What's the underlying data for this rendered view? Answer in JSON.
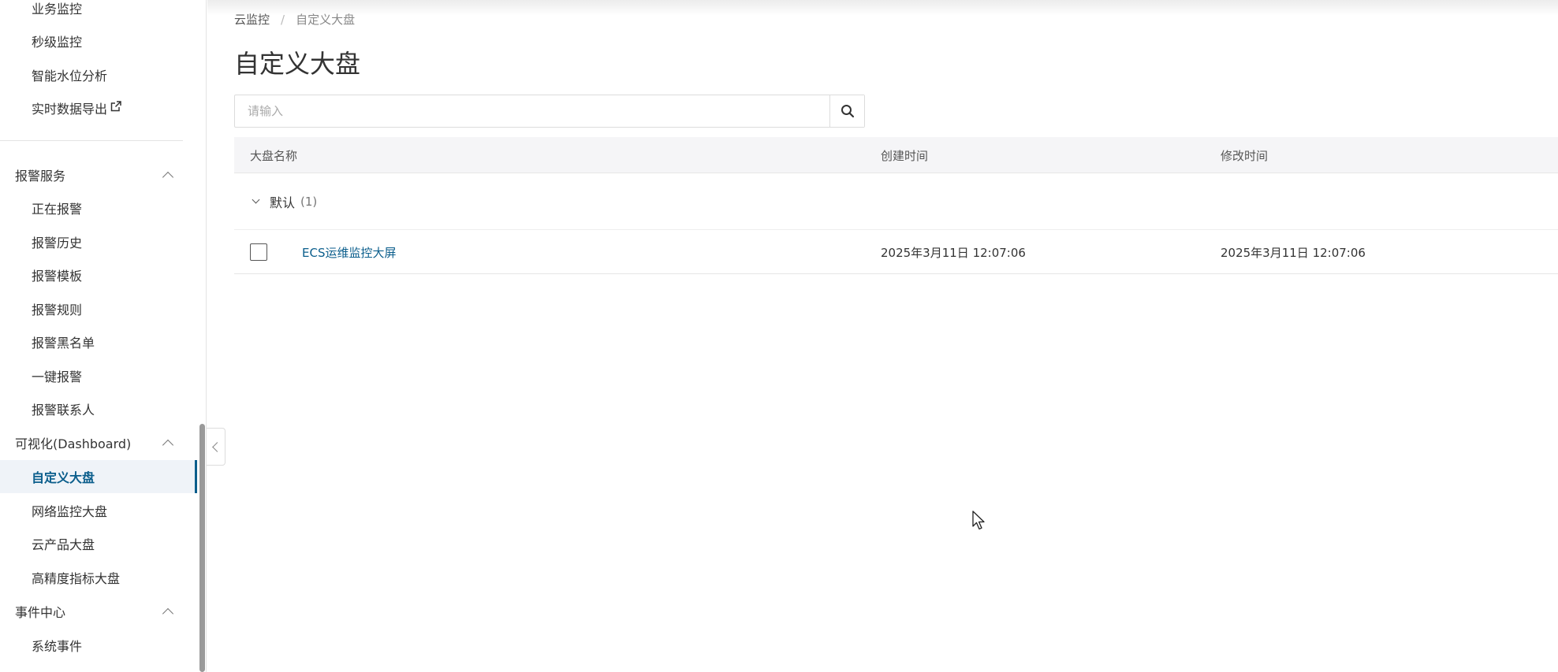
{
  "sidebar": {
    "top_items": [
      {
        "label": "业务监控"
      },
      {
        "label": "秒级监控"
      },
      {
        "label": "智能水位分析"
      },
      {
        "label": "实时数据导出"
      }
    ],
    "groups": [
      {
        "label": "报警服务",
        "items": [
          {
            "label": "正在报警"
          },
          {
            "label": "报警历史"
          },
          {
            "label": "报警模板"
          },
          {
            "label": "报警规则"
          },
          {
            "label": "报警黑名单"
          },
          {
            "label": "一键报警"
          },
          {
            "label": "报警联系人"
          }
        ]
      },
      {
        "label": "可视化(Dashboard)",
        "items": [
          {
            "label": "自定义大盘",
            "active": true
          },
          {
            "label": "网络监控大盘"
          },
          {
            "label": "云产品大盘"
          },
          {
            "label": "高精度指标大盘"
          }
        ]
      },
      {
        "label": "事件中心",
        "items": [
          {
            "label": "系统事件"
          }
        ]
      }
    ]
  },
  "breadcrumb": {
    "root": "云监控",
    "separator": "/",
    "current": "自定义大盘"
  },
  "page_title": "自定义大盘",
  "search": {
    "placeholder": "请输入",
    "value": ""
  },
  "table": {
    "columns": [
      "大盘名称",
      "创建时间",
      "修改时间"
    ],
    "group": {
      "name": "默认",
      "count": "(1)"
    },
    "rows": [
      {
        "name": "ECS运维监控大屏",
        "created": "2025年3月11日 12:07:06",
        "modified": "2025年3月11日 12:07:06"
      }
    ]
  },
  "colors": {
    "accent": "#0b5e8c",
    "active_bg": "#eff3f8",
    "header_bg": "#f5f5f7"
  }
}
